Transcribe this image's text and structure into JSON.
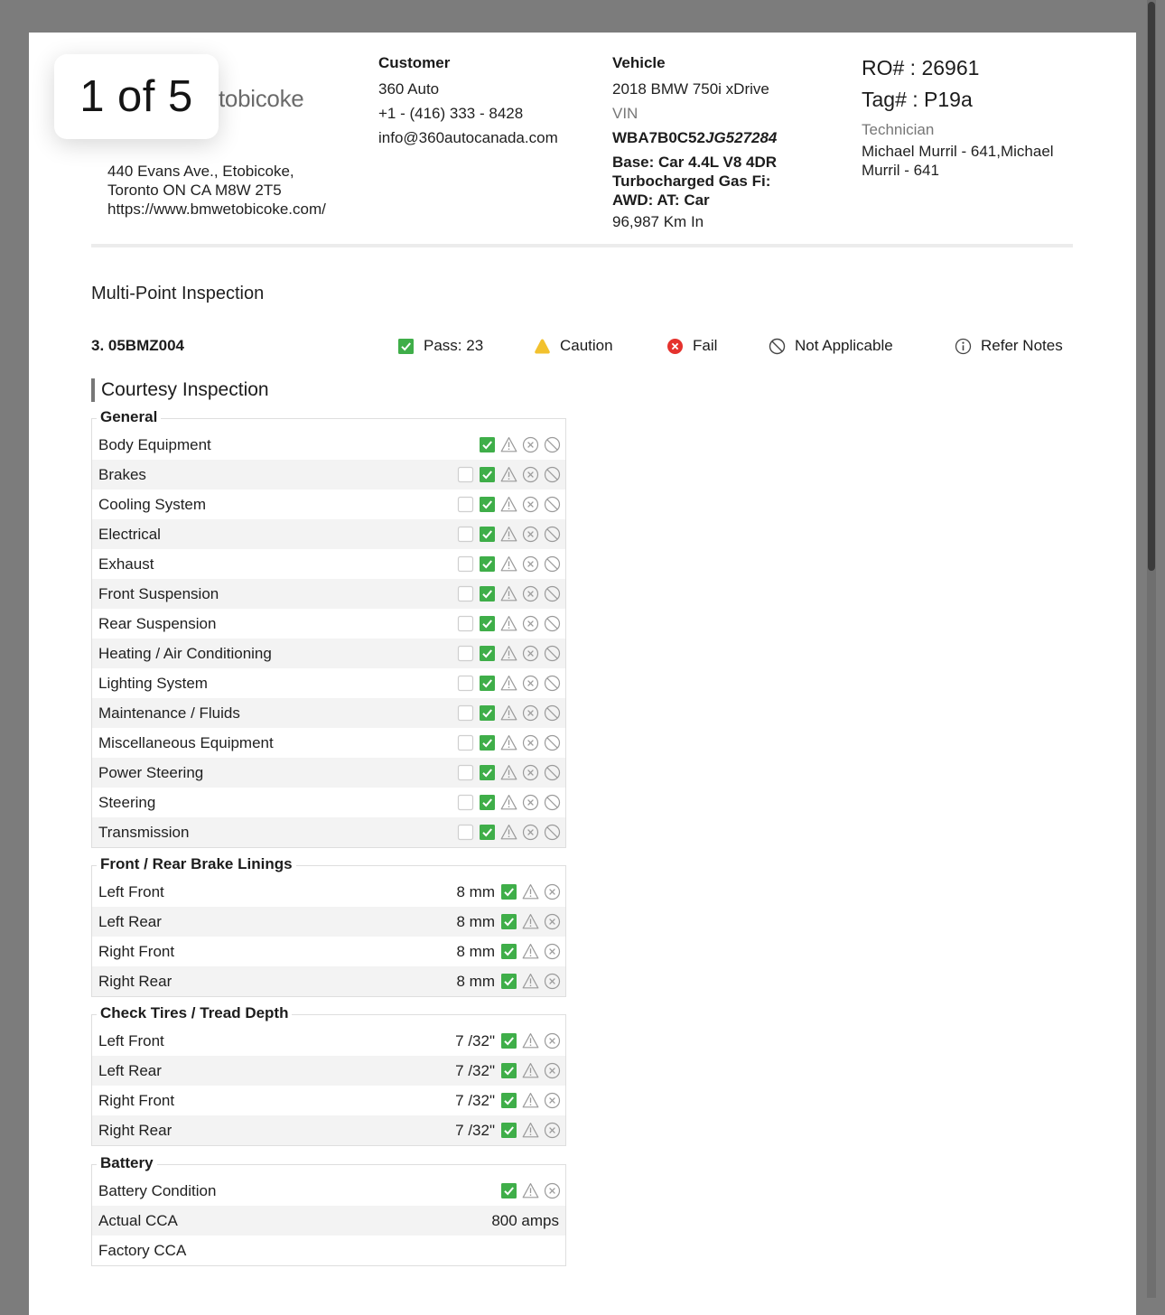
{
  "page_indicator": "1 of 5",
  "dealer": {
    "logo_text": "tobicoke",
    "address_lines": [
      "440 Evans Ave., Etobicoke,",
      "Toronto ON CA M8W 2T5",
      "https://www.bmwetobicoke.com/"
    ]
  },
  "customer": {
    "label": "Customer",
    "name": "360 Auto",
    "phone": "+1 - (416) 333 - 8428",
    "email": "info@360autocanada.com"
  },
  "vehicle": {
    "label": "Vehicle",
    "model": "2018 BMW 750i xDrive",
    "vin_label": "VIN",
    "vin_prefix": "WBA7B0C52",
    "vin_suffix": "JG527284",
    "base_lines": [
      "Base: Car 4.4L V8 4DR",
      "Turbocharged Gas Fi:",
      "AWD: AT: Car"
    ],
    "mileage": "96,987 Km In"
  },
  "repair_order": {
    "ro": "RO# : 26961",
    "tag": "Tag# : P19a",
    "technician_label": "Technician",
    "technician_lines": [
      "Michael Murril - 641,Michael",
      "Murril - 641"
    ]
  },
  "inspection": {
    "title": "Multi-Point Inspection",
    "code": "3. 05BMZ004",
    "legend": {
      "pass": "Pass: 23",
      "caution": "Caution",
      "fail": "Fail",
      "not_applicable": "Not Applicable",
      "refer_notes": "Refer Notes"
    },
    "section_title": "Courtesy Inspection",
    "colors": {
      "pass": "#3fae49",
      "caution": "#f2c12e",
      "fail": "#e5322d"
    },
    "groups": {
      "general": {
        "title": "General",
        "rows": [
          {
            "label": "Body Equipment",
            "status": "pass"
          },
          {
            "label": "Brakes",
            "status": "pass"
          },
          {
            "label": "Cooling System",
            "status": "pass"
          },
          {
            "label": "Electrical",
            "status": "pass"
          },
          {
            "label": "Exhaust",
            "status": "pass"
          },
          {
            "label": "Front Suspension",
            "status": "pass"
          },
          {
            "label": "Rear Suspension",
            "status": "pass"
          },
          {
            "label": "Heating / Air Conditioning",
            "status": "pass"
          },
          {
            "label": "Lighting System",
            "status": "pass"
          },
          {
            "label": "Maintenance / Fluids",
            "status": "pass"
          },
          {
            "label": "Miscellaneous Equipment",
            "status": "pass"
          },
          {
            "label": "Power Steering",
            "status": "pass"
          },
          {
            "label": "Steering",
            "status": "pass"
          },
          {
            "label": "Transmission",
            "status": "pass"
          }
        ]
      },
      "brakes": {
        "title": "Front / Rear Brake Linings",
        "rows": [
          {
            "label": "Left Front",
            "value": "8 mm",
            "status": "pass"
          },
          {
            "label": "Left Rear",
            "value": "8 mm",
            "status": "pass"
          },
          {
            "label": "Right Front",
            "value": "8 mm",
            "status": "pass"
          },
          {
            "label": "Right Rear",
            "value": "8 mm",
            "status": "pass"
          }
        ]
      },
      "tires": {
        "title": "Check Tires / Tread Depth",
        "rows": [
          {
            "label": "Left Front",
            "value": "7 /32\"",
            "status": "pass"
          },
          {
            "label": "Left Rear",
            "value": "7 /32\"",
            "status": "pass"
          },
          {
            "label": "Right Front",
            "value": "7 /32\"",
            "status": "pass"
          },
          {
            "label": "Right Rear",
            "value": "7 /32\"",
            "status": "pass"
          }
        ]
      },
      "battery": {
        "title": "Battery",
        "rows": [
          {
            "label": "Battery Condition",
            "status": "pass"
          },
          {
            "label": "Actual CCA",
            "value": "800 amps"
          },
          {
            "label": "Factory CCA",
            "value": ""
          }
        ]
      }
    }
  }
}
